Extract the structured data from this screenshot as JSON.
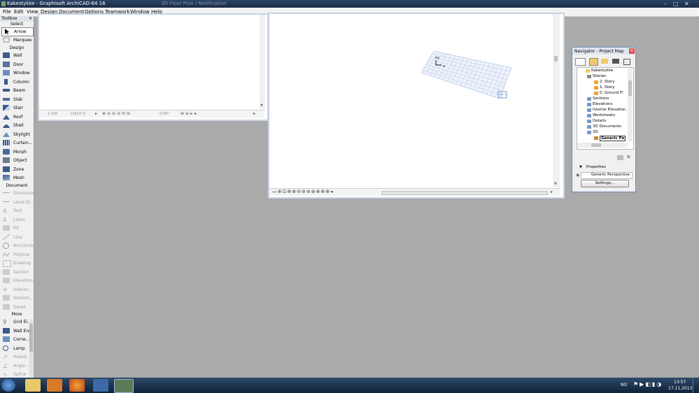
{
  "app": {
    "title": "Kakestykke - Graphisoft ArchiCAD-64 16",
    "ghost_title": "3D Floor Plan / Notification",
    "window_controls": [
      "–",
      "□",
      "✕"
    ]
  },
  "menu": [
    "File",
    "Edit",
    "View",
    "Design",
    "Document",
    "Options",
    "Teamwork",
    "Window",
    "Help"
  ],
  "toolbox": {
    "title": "Toolbox",
    "sections": {
      "select": "Select",
      "design": "Design",
      "document": "Document",
      "more": "More"
    },
    "select_tools": [
      "Arrow",
      "Marquee"
    ],
    "design_tools": [
      "Wall",
      "Door",
      "Window",
      "Column",
      "Beam",
      "Slab",
      "Stair",
      "Roof",
      "Shell",
      "Skylight",
      "Curtain...",
      "Morph",
      "Object",
      "Zone",
      "Mesh"
    ],
    "document_tools": [
      "Dimension",
      "Level Di...",
      "Text",
      "Label",
      "Fill",
      "Line",
      "Arc/Circle",
      "Polyline",
      "Drawing",
      "Section",
      "Elevation",
      "Interior...",
      "Worksh...",
      "Detail"
    ],
    "more_tools": [
      "Grid El...",
      "Wall End",
      "Corne...",
      "Lamp",
      "Radial...",
      "Angle ...",
      "Spline"
    ]
  },
  "plan_window": {
    "scale": "1:100",
    "zoom": "11614 %",
    "angle": "0.00°"
  },
  "view3d_window": {
    "axis_y": "y",
    "axis_z": "z",
    "axis_x": "x"
  },
  "navigator": {
    "title": "Navigator - Project Map",
    "project": "Kakestykke",
    "tree": [
      "Stories",
      "2. Story",
      "1. Story",
      "0. Ground Fl",
      "Sections",
      "Elevations",
      "Interior Elevation",
      "Worksheets",
      "Details",
      "3D Documents",
      "3D",
      "Generic Pe"
    ],
    "properties_label": "Properties",
    "properties_value": "Generic Perspective",
    "settings_label": "Settings..."
  },
  "tray": {
    "language": "NO",
    "time": "13:57",
    "date": "17.11.2013"
  },
  "colors": {
    "titlebar": "#1b2d47",
    "workspace": "#aaaaaa",
    "grid": "#a9bde0",
    "accent": "#6b8cb4"
  }
}
